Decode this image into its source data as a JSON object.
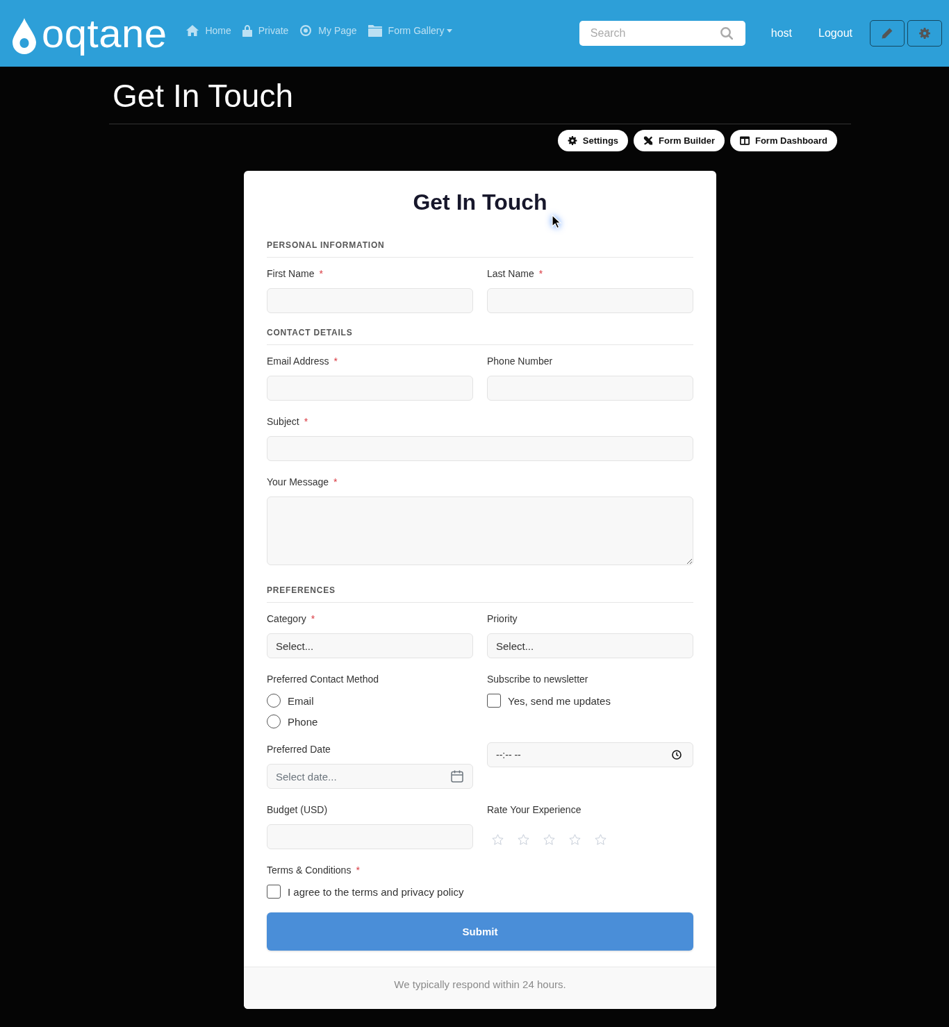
{
  "header": {
    "logo": "oqtane",
    "nav": [
      {
        "label": "Home",
        "dropdown": false
      },
      {
        "label": "Private",
        "dropdown": false
      },
      {
        "label": "My Page",
        "dropdown": false
      },
      {
        "label": "Form Gallery",
        "dropdown": true
      }
    ],
    "search": {
      "placeholder": "Search"
    },
    "user": "host",
    "logout": "Logout"
  },
  "page": {
    "title": "Get In Touch",
    "actions": [
      {
        "label": "Settings"
      },
      {
        "label": "Form Builder"
      },
      {
        "label": "Form Dashboard"
      }
    ]
  },
  "form": {
    "title": "Get In Touch",
    "required_mark": "*",
    "sections": [
      {
        "heading": "PERSONAL INFORMATION",
        "rows": [
          [
            {
              "kind": "text",
              "label": "First Name",
              "required": true
            },
            {
              "kind": "text",
              "label": "Last Name",
              "required": true
            }
          ]
        ]
      },
      {
        "heading": "CONTACT DETAILS",
        "rows": [
          [
            {
              "kind": "text",
              "label": "Email Address",
              "required": true
            },
            {
              "kind": "text",
              "label": "Phone Number",
              "required": false
            }
          ],
          [
            {
              "kind": "text",
              "label": "Subject",
              "required": true
            }
          ],
          [
            {
              "kind": "textarea",
              "label": "Your Message",
              "required": true
            }
          ]
        ]
      },
      {
        "heading": "PREFERENCES",
        "rows": [
          [
            {
              "kind": "select",
              "label": "Category",
              "required": true,
              "value": "Select..."
            },
            {
              "kind": "select",
              "label": "Priority",
              "required": false,
              "value": "Select..."
            }
          ],
          [
            {
              "kind": "radio",
              "label": "Preferred Contact Method",
              "required": false,
              "options": [
                {
                  "label": "Email",
                  "selected": false
                },
                {
                  "label": "Phone",
                  "selected": false
                }
              ]
            },
            {
              "kind": "checkbox",
              "label": "Subscribe to newsletter",
              "required": false,
              "option": {
                "label": "Yes, send me updates",
                "checked": false
              }
            }
          ],
          [
            {
              "kind": "date",
              "label": "Preferred Date",
              "required": false,
              "placeholder": "Select date..."
            },
            {
              "kind": "time",
              "value": "--:-- --"
            }
          ],
          [
            {
              "kind": "text",
              "label": "Budget (USD)",
              "required": false
            },
            {
              "kind": "stars",
              "label": "Rate Your Experience",
              "required": false,
              "stars": 0
            }
          ],
          [
            {
              "kind": "checkbox",
              "label": "Terms & Conditions",
              "required": true,
              "option": {
                "label": "I agree to the terms and privacy policy",
                "checked": false
              }
            }
          ]
        ]
      }
    ],
    "submit": "Submit",
    "footer_note": "We typically respond within 24 hours."
  }
}
